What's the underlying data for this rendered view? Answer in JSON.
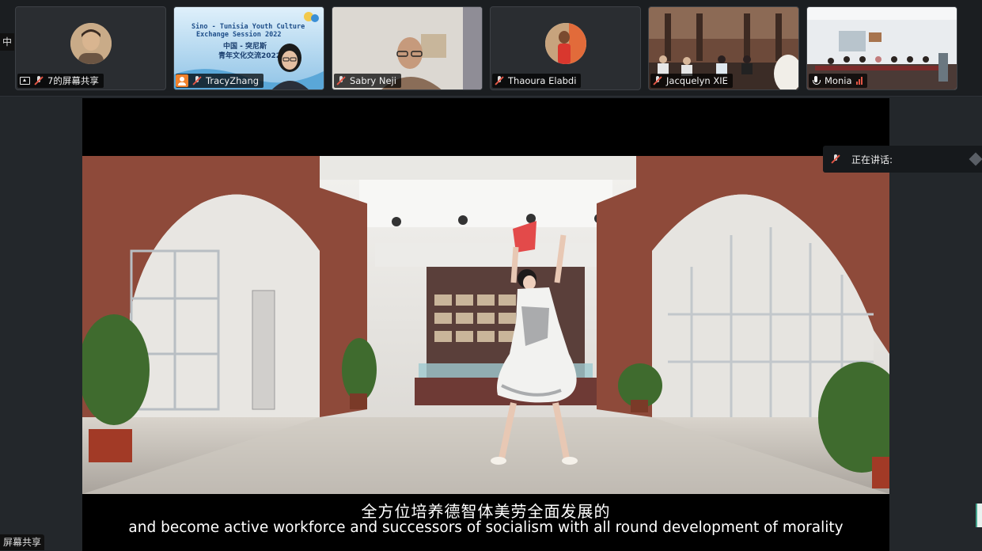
{
  "participants": [
    {
      "name": "7的屏幕共享",
      "sharing": true,
      "muted": true
    },
    {
      "name": "TracyZhang",
      "host": true,
      "muted": true,
      "slide": {
        "title_line1": "Sino - Tunisia Youth Culture",
        "title_line2": "Exchange Session 2022",
        "cn_line1": "中国 - 突尼斯",
        "cn_line2": "青年文化交流2022"
      }
    },
    {
      "name": "Sabry Neji",
      "muted": true
    },
    {
      "name": "Thaoura Elabdi",
      "muted": true
    },
    {
      "name": "Jacquelyn XIE",
      "muted": true
    },
    {
      "name": "Monia",
      "muted": false
    }
  ],
  "left_chip": "中",
  "bottom_chip": "屏幕共享",
  "speaking_label": "正在讲话:",
  "subtitles": {
    "cn": "全方位培养德智体美劳全面发展的",
    "en": "and become active workforce and successors of socialism with all round development of morality"
  },
  "colors": {
    "accent_orange": "#f0822d",
    "muted_red": "#e25545",
    "brick": "#8e4a3a"
  }
}
